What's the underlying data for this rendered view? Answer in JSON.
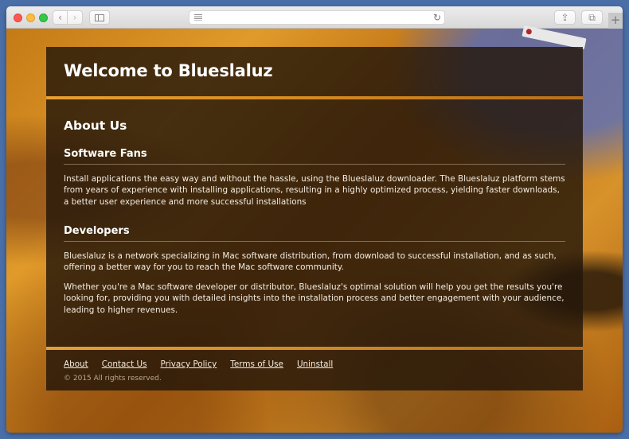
{
  "browser": {
    "nav_back_icon": "chevron-left-icon",
    "nav_forward_icon": "chevron-right-icon",
    "sidebar_icon": "sidebar-icon",
    "reader_icon": "reader-lines-icon",
    "reload_icon": "reload-icon",
    "reload_glyph": "↻",
    "share_icon": "share-icon",
    "share_glyph": "⇪",
    "tabs_icon": "tabs-overview-icon",
    "tabs_glyph": "⧉",
    "new_tab_glyph": "+",
    "back_glyph": "‹",
    "forward_glyph": "›",
    "address_value": ""
  },
  "page": {
    "title": "Welcome to Blueslaluz",
    "about_heading": "About Us",
    "sections": [
      {
        "heading": "Software Fans",
        "paragraphs": [
          "Install applications the easy way and without the hassle, using the Blueslaluz downloader. The Blueslaluz platform stems from years of experience with installing applications, resulting in a highly optimized process, yielding faster downloads, a better user experience and more successful installations"
        ]
      },
      {
        "heading": "Developers",
        "paragraphs": [
          "Blueslaluz is a network specializing in Mac software distribution, from download to successful installation, and as such, offering a better way for you to reach the Mac software community.",
          "Whether you're a Mac software developer or distributor, Blueslaluz's optimal solution will help you get the results you're looking for, providing you with detailed insights into the installation process and better engagement with your audience, leading to higher revenues."
        ]
      }
    ]
  },
  "footer": {
    "links": [
      "About",
      "Contact Us",
      "Privacy Policy",
      "Terms of Use",
      "Uninstall"
    ],
    "copyright": "© 2015 All rights reserved."
  },
  "colors": {
    "accent_stripe": "#e8a030",
    "panel_bg": "#23160a",
    "desktop_bg": "#4a6fa8"
  }
}
